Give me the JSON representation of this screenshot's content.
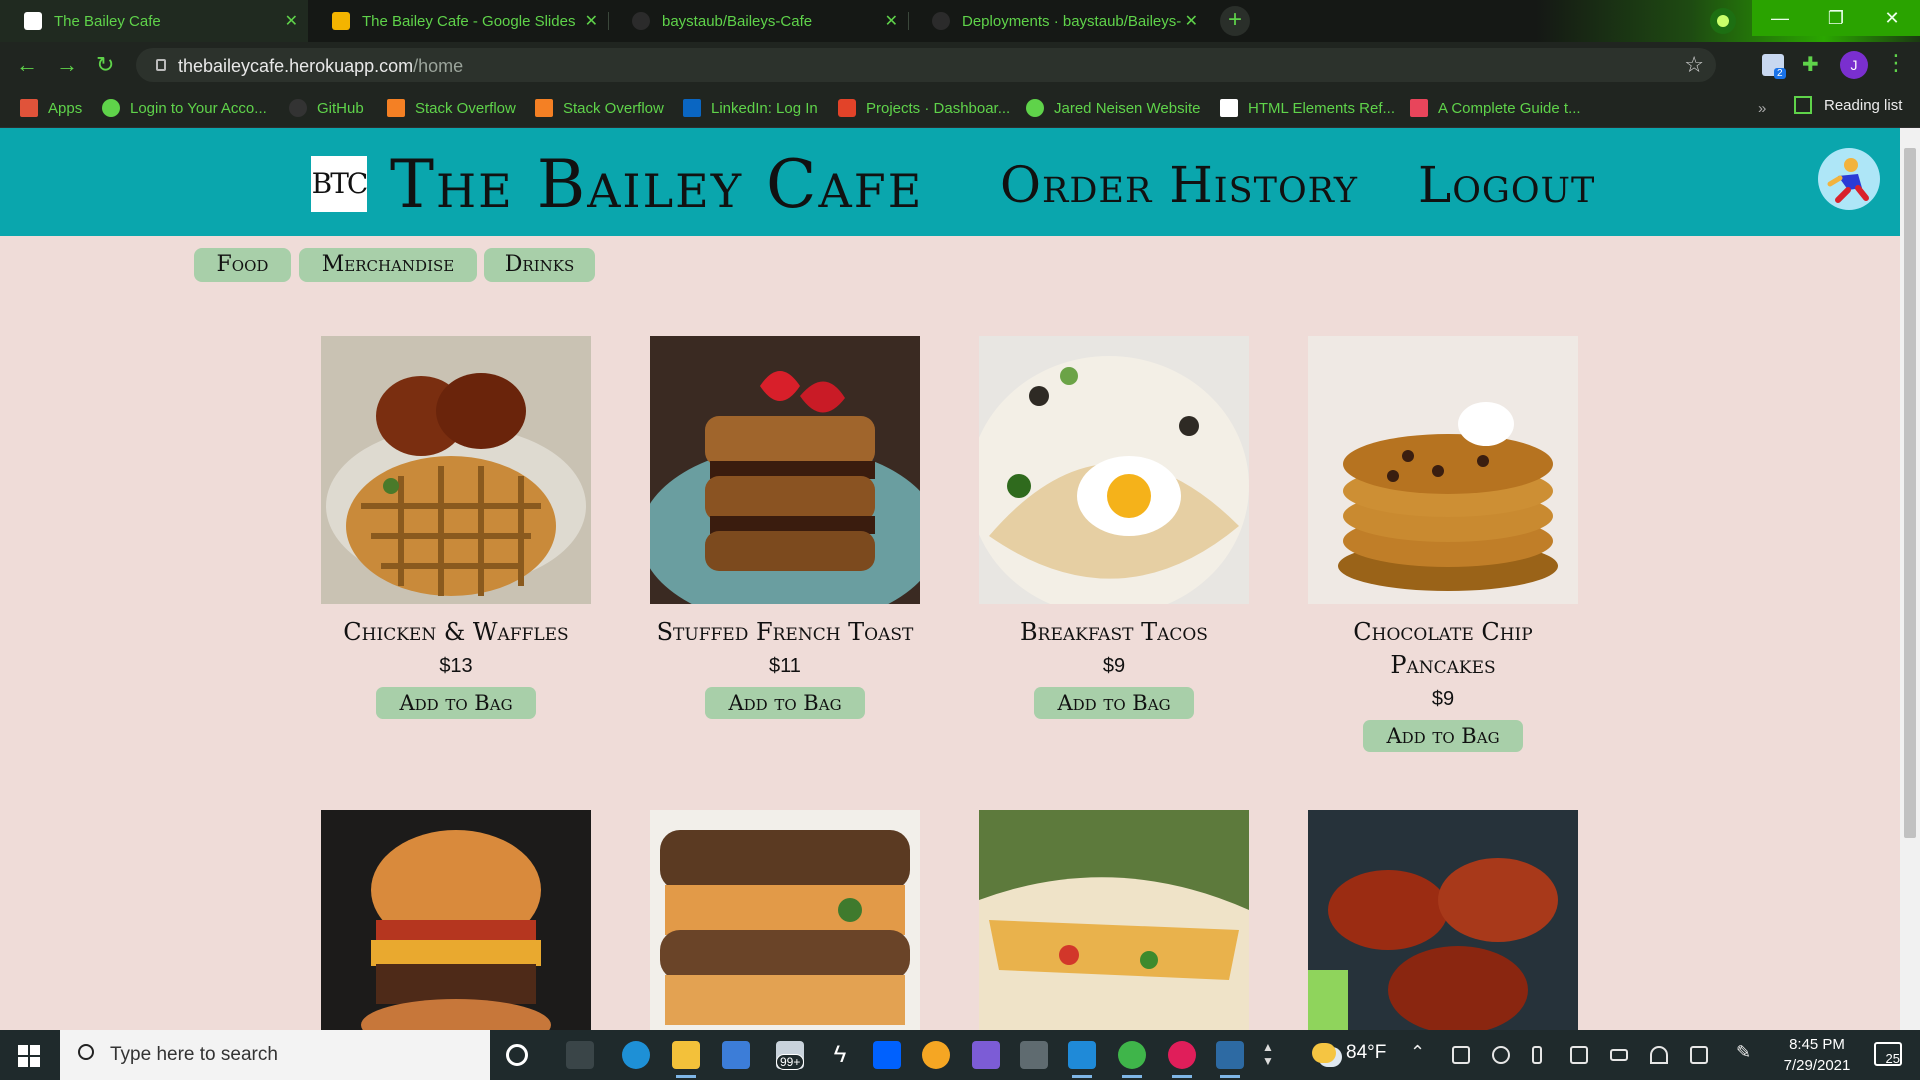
{
  "browser": {
    "tabs": [
      {
        "title": "The Bailey Cafe",
        "active": true,
        "favicon_color": "#ffffff"
      },
      {
        "title": "The Bailey Cafe - Google Slides",
        "active": false,
        "favicon_color": "#f4b400"
      },
      {
        "title": "baystaub/Baileys-Cafe",
        "active": false,
        "favicon_color": "#2b2b2b"
      },
      {
        "title": "Deployments · baystaub/Baileys-",
        "active": false,
        "favicon_color": "#2b2b2b"
      }
    ],
    "new_tab_label": "+",
    "url_host": "thebaileycafe.herokuapp.com",
    "url_path": "/home",
    "profile_initial": "J",
    "extension_badge": "2",
    "bookmarks": [
      {
        "label": "Apps",
        "icon": "apps-grid-icon",
        "color": "#e0533a"
      },
      {
        "label": "Login to Your Acco...",
        "icon": "globe-icon",
        "color": "#5fd34a"
      },
      {
        "label": "GitHub",
        "icon": "github-icon",
        "color": "#333333"
      },
      {
        "label": "Stack Overflow",
        "icon": "stackoverflow-icon",
        "color": "#f48024"
      },
      {
        "label": "Stack Overflow",
        "icon": "stackoverflow-icon",
        "color": "#f48024"
      },
      {
        "label": "LinkedIn: Log In",
        "icon": "linkedin-icon",
        "color": "#0a66c2"
      },
      {
        "label": "Projects · Dashboar...",
        "icon": "gitlab-icon",
        "color": "#e24329"
      },
      {
        "label": "Jared Neisen Website",
        "icon": "globe-icon",
        "color": "#5fd34a"
      },
      {
        "label": "HTML Elements Ref...",
        "icon": "mdn-icon",
        "color": "#ffffff"
      },
      {
        "label": "A Complete Guide t...",
        "icon": "csstricks-icon",
        "color": "#e8455b"
      }
    ],
    "overflow_chevron": "»",
    "reading_list": "Reading list"
  },
  "site": {
    "logo_text": "BTC",
    "brand": "The Bailey Cafe",
    "nav": {
      "order_history": "Order History",
      "logout": "Logout"
    },
    "categories": [
      "Food",
      "Merchandise",
      "Drinks"
    ],
    "add_label": "Add to Bag",
    "products_row1": [
      {
        "name": "Chicken & Waffles",
        "price": "$13"
      },
      {
        "name": "Stuffed French Toast",
        "price": "$11"
      },
      {
        "name": "Breakfast Tacos",
        "price": "$9"
      },
      {
        "name": "Chocolate Chip Pancakes",
        "price": "$9"
      }
    ],
    "header_color": "#0aa6ad",
    "background_color": "#efdcd8",
    "button_color": "#a8cfa9"
  },
  "taskbar": {
    "search_placeholder": "Type here to search",
    "mail_badge": "99+",
    "weather": "84°F",
    "time": "8:45 PM",
    "date": "7/29/2021",
    "notification_count": "25"
  }
}
